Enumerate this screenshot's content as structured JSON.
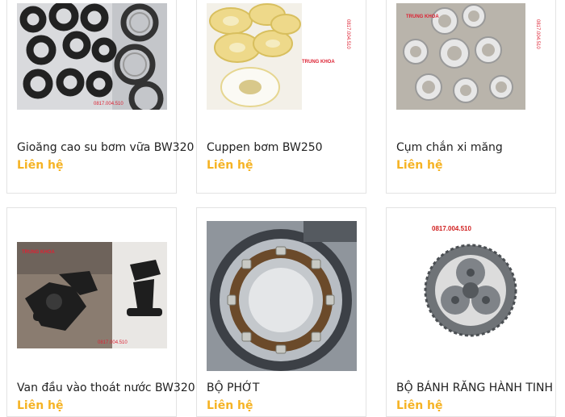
{
  "products": [
    {
      "name": "Gioăng cao su bơm vữa BW320",
      "price": "Liên hệ"
    },
    {
      "name": "Cuppen bơm BW250",
      "price": "Liên hệ"
    },
    {
      "name": "Cụm chắn xi măng",
      "price": "Liên hệ"
    },
    {
      "name": "Van đầu vào thoát nước BW320",
      "price": "Liên hệ"
    },
    {
      "name": "BỘ PHỚT",
      "price": "Liên hệ"
    },
    {
      "name": "BỘ BÁNH RĂNG HÀNH TINH",
      "price": "Liên hệ"
    }
  ],
  "watermarks": {
    "brand": "TRUNG KHOA",
    "phone": "0817.004.510"
  },
  "colors": {
    "price": "#f5b324",
    "border": "#e3e3e3",
    "text": "#222222"
  }
}
